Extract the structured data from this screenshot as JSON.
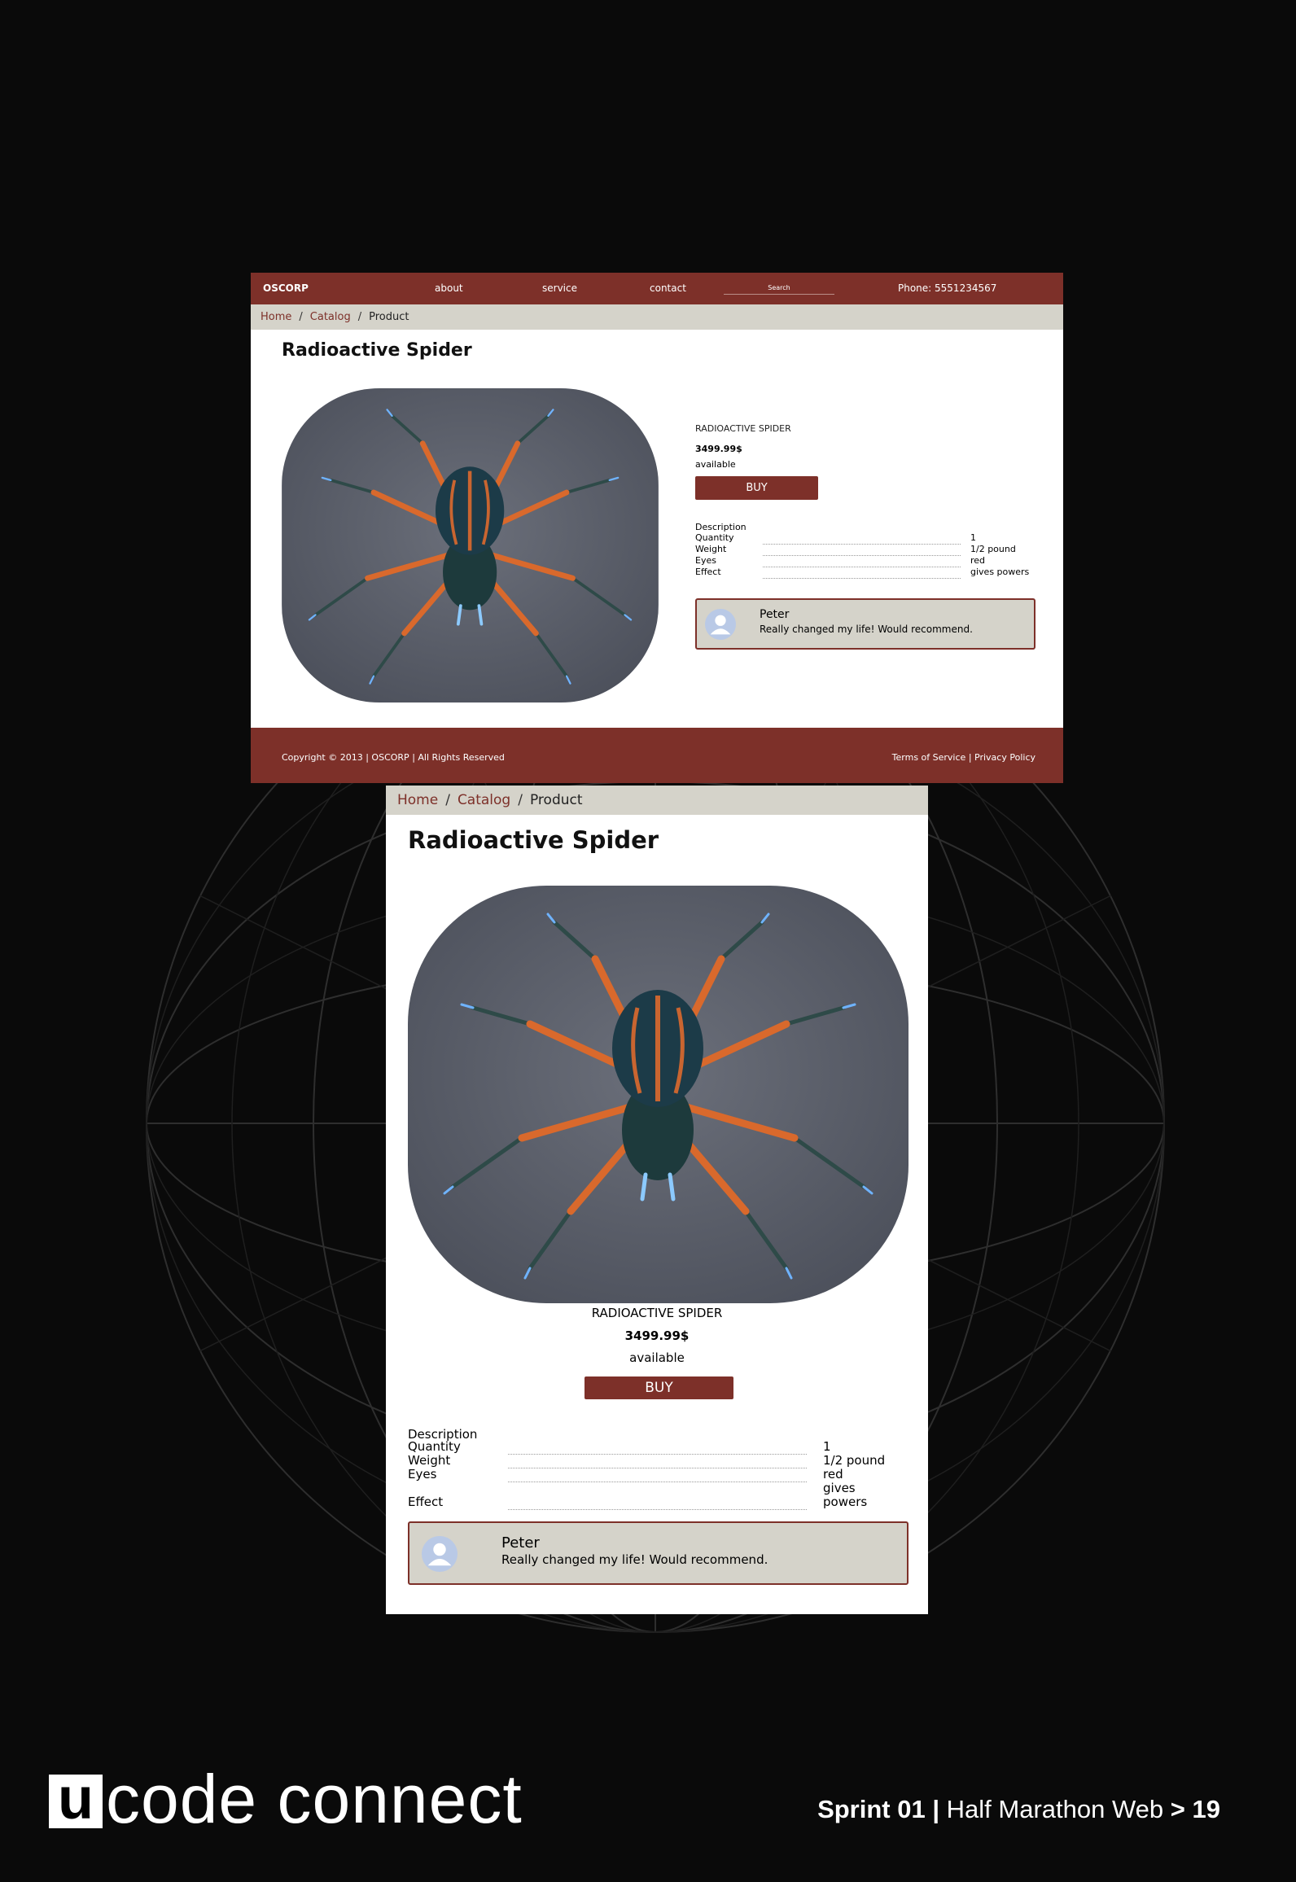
{
  "desktop": {
    "logo": "OSCORP",
    "nav": [
      "about",
      "service",
      "contact"
    ],
    "search_placeholder": "Search",
    "phone": "Phone: 5551234567",
    "breadcrumb": [
      "Home",
      "Catalog",
      "Product"
    ],
    "footer": {
      "copyright": "Copyright © 2013 | OSCORP | All Rights Reserved",
      "terms": "Terms of Service",
      "separator": "|",
      "privacy": "Privacy Policy"
    }
  },
  "mobile": {
    "breadcrumb": [
      "Home",
      "Catalog",
      "Product"
    ]
  },
  "product": {
    "title": "Radioactive Spider",
    "name": "RADIOACTIVE SPIDER",
    "price": "3499.99$",
    "availability": "available",
    "buy_label": "BUY",
    "description_label": "Description",
    "specs": [
      {
        "key": "Quantity",
        "value": "1"
      },
      {
        "key": "Weight",
        "value": "1/2 pound"
      },
      {
        "key": "Eyes",
        "value": "red"
      },
      {
        "key": "Effect",
        "value": "gives powers"
      }
    ]
  },
  "review": {
    "name": "Peter",
    "text": "Really changed my life! Would recommend."
  },
  "slide": {
    "brand_letter": "u",
    "brand_rest": "code connect",
    "sprint": "Sprint 01",
    "separator": "|",
    "course": "Half Marathon Web",
    "arrow": ">",
    "page": "19"
  },
  "colors": {
    "accent": "#7d3029",
    "breadcrumb_bg": "#d5d3ca",
    "slide_bg": "#0a0a0a",
    "photo_bg": "#5b5f6b",
    "spider_leg": "#d9692c"
  },
  "icons": {
    "avatar": "user-avatar-icon",
    "spider": "spider-image"
  }
}
